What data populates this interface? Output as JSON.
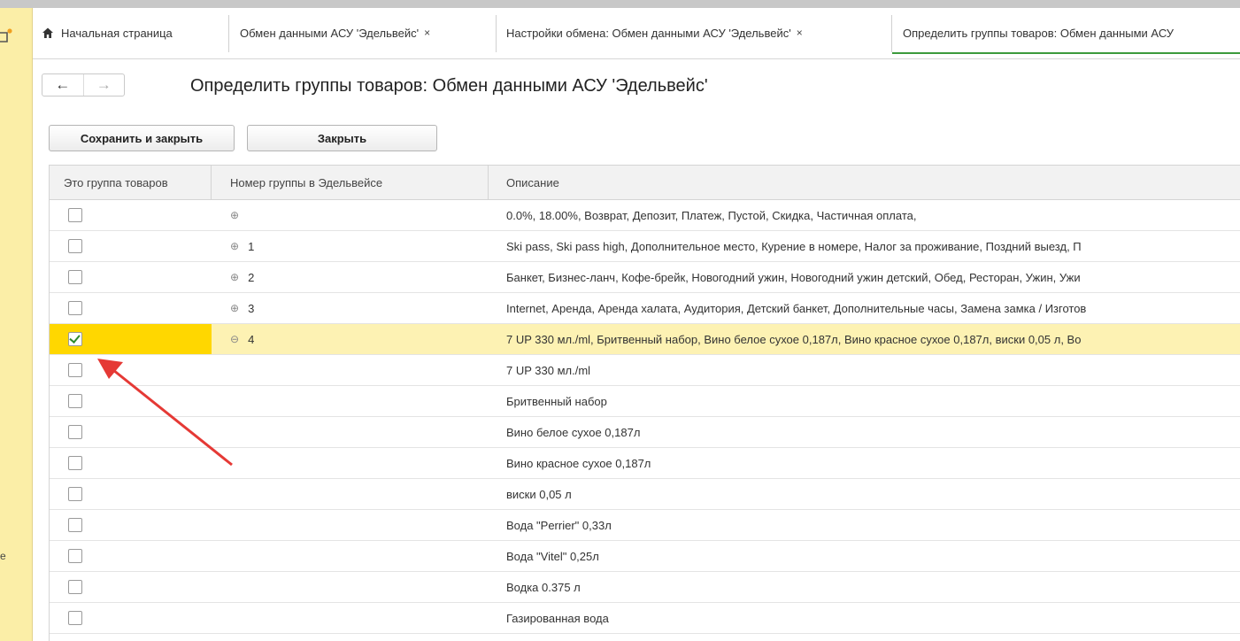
{
  "tabs": [
    {
      "label": "Начальная страница",
      "icon": "home-icon",
      "closable": false
    },
    {
      "label": "Обмен данными АСУ 'Эдельвейс'",
      "closable": true
    },
    {
      "label": "Настройки обмена: Обмен данными АСУ 'Эдельвейс'",
      "closable": true
    },
    {
      "label": "Определить группы товаров: Обмен данными АСУ",
      "closable": false,
      "active": true
    }
  ],
  "close_glyph": "×",
  "nav": {
    "back": "←",
    "forward": "→"
  },
  "page": {
    "title": "Определить группы товаров: Обмен данными АСУ 'Эдельвейс'"
  },
  "toolbar": {
    "save_close_label": "Сохранить и закрыть",
    "close_label": "Закрыть"
  },
  "table": {
    "headers": [
      "Это группа товаров",
      "Номер группы в Эдельвейсе",
      "Описание"
    ],
    "rows": [
      {
        "checked": false,
        "expander": "⊕",
        "group": "",
        "description": "0.0%, 18.00%, Возврат, Депозит, Платеж, Пустой, Скидка, Частичная оплата,"
      },
      {
        "checked": false,
        "expander": "⊕",
        "group": "1",
        "description": "Ski pass, Ski pass high, Дополнительное место, Курение в номере, Налог за проживание, Поздний выезд, П"
      },
      {
        "checked": false,
        "expander": "⊕",
        "group": "2",
        "description": "Банкет, Бизнес-ланч, Кофе-брейк, Новогодний ужин, Новогодний ужин детский, Обед, Ресторан, Ужин, Ужи"
      },
      {
        "checked": false,
        "expander": "⊕",
        "group": "3",
        "description": "Internet, Аренда, Аренда халата, Аудитория, Детский банкет, Дополнительные часы, Замена замка / Изготов"
      },
      {
        "checked": true,
        "selected": true,
        "expander": "⊖",
        "group": "4",
        "description": "7 UP 330 мл./ml, Бритвенный набор, Вино белое сухое 0,187л, Вино красное сухое 0,187л, виски 0,05 л, Во"
      },
      {
        "checked": false,
        "expander": "",
        "group": "",
        "description": "7 UP 330 мл./ml"
      },
      {
        "checked": false,
        "expander": "",
        "group": "",
        "description": "Бритвенный набор"
      },
      {
        "checked": false,
        "expander": "",
        "group": "",
        "description": "Вино белое сухое 0,187л"
      },
      {
        "checked": false,
        "expander": "",
        "group": "",
        "description": "Вино красное сухое 0,187л"
      },
      {
        "checked": false,
        "expander": "",
        "group": "",
        "description": "виски 0,05 л"
      },
      {
        "checked": false,
        "expander": "",
        "group": "",
        "description": "Вода \"Perrier\" 0,33л"
      },
      {
        "checked": false,
        "expander": "",
        "group": "",
        "description": "Вода \"Vitel\" 0,25л"
      },
      {
        "checked": false,
        "expander": "",
        "group": "",
        "description": "Водка 0.375 л"
      },
      {
        "checked": false,
        "expander": "",
        "group": "",
        "description": "Газированная вода"
      }
    ]
  },
  "sidebar": {
    "partial_letter": "е"
  },
  "colors": {
    "selected_row": "#fdf2b3",
    "selected_check_cell": "#ffd700",
    "active_tab_underline": "#3c9a3c",
    "annotation_arrow": "#e53935",
    "sidebar_bg": "#fbeea7"
  }
}
